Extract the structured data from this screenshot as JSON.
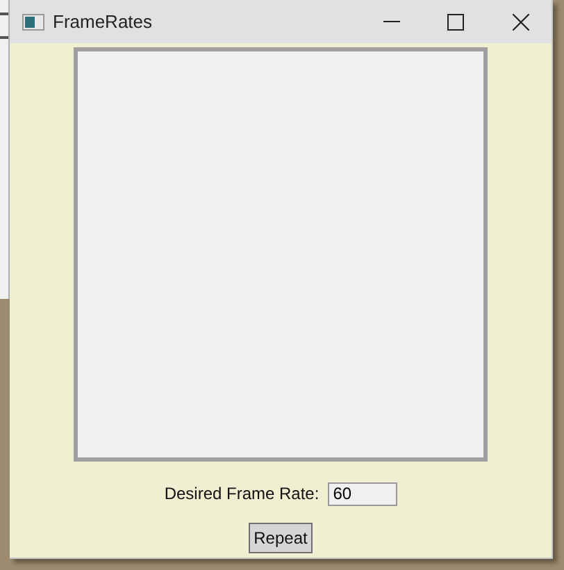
{
  "window": {
    "title": "FrameRates"
  },
  "canvas": {
    "kind": "blank"
  },
  "frame_rate": {
    "label": "Desired Frame Rate:",
    "value": "60"
  },
  "buttons": [
    "Repeat"
  ]
}
